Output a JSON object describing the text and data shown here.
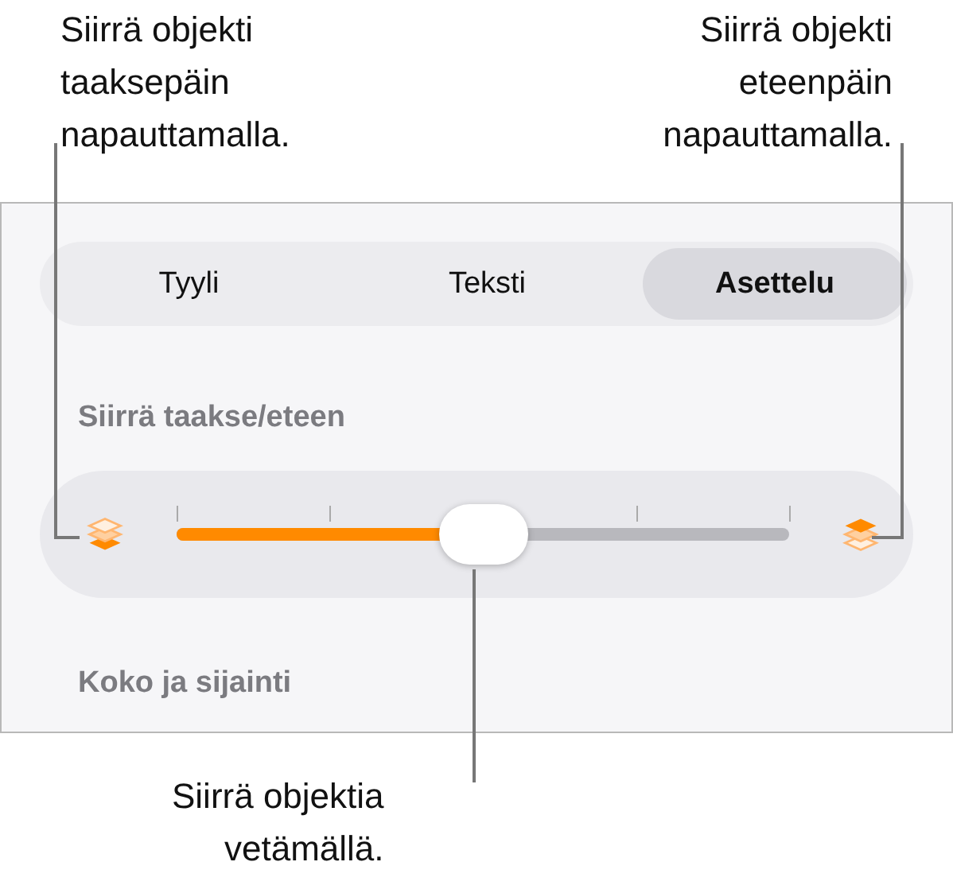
{
  "callouts": {
    "backward": "Siirrä objekti\ntaaksepäin\nnapauttamalla.",
    "forward": "Siirrä objekti\neteenpäin\nnapauttamalla.",
    "drag": "Siirrä objektia\nvetämällä."
  },
  "tabs": [
    {
      "label": "Tyyli",
      "selected": false
    },
    {
      "label": "Teksti",
      "selected": false
    },
    {
      "label": "Asettelu",
      "selected": true
    }
  ],
  "arrange": {
    "heading": "Siirrä taakse/eteen",
    "level": 0.5
  },
  "size_heading": "Koko ja sijainti"
}
